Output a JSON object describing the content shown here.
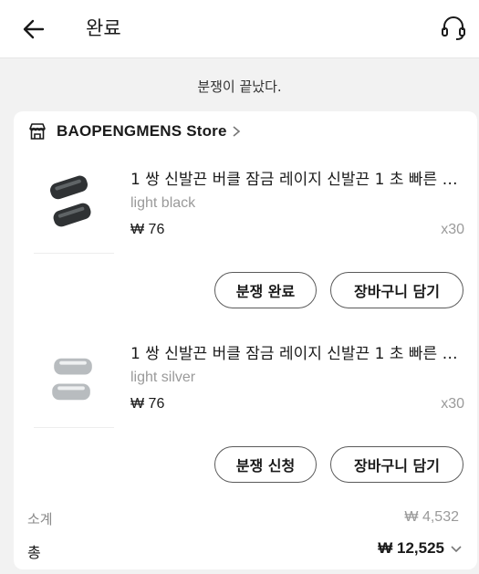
{
  "header": {
    "title": "완료"
  },
  "status": "분쟁이 끝났다.",
  "store": {
    "name": "BAOPENGMENS Store"
  },
  "items": [
    {
      "name": "1 쌍 신발끈 버클 잠금 레이지 신발끈 1 초 빠른 잠금 신발끈",
      "variant": "light black",
      "price": "₩ 76",
      "qty": "x30",
      "primary_button": "분쟁 완료",
      "cart_button": "장바구니 담기",
      "thumb_color": "#2f3234"
    },
    {
      "name": "1 쌍 신발끈 버클 잠금 레이지 신발끈 1 초 빠른 잠금 신발끈",
      "variant": "light silver",
      "price": "₩ 76",
      "qty": "x30",
      "primary_button": "분쟁 신청",
      "cart_button": "장바구니 담기",
      "thumb_color": "#b8bcbf"
    }
  ],
  "summary": {
    "subtotal_label": "소계",
    "subtotal_value": "₩ 4,532",
    "total_label": "총",
    "total_value": "₩ 12,525"
  },
  "icons": {
    "back": "arrow-left-icon",
    "support": "headset-icon",
    "store": "storefront-icon",
    "store_chevron": "chevron-right-icon",
    "total_chevron": "chevron-down-icon"
  }
}
